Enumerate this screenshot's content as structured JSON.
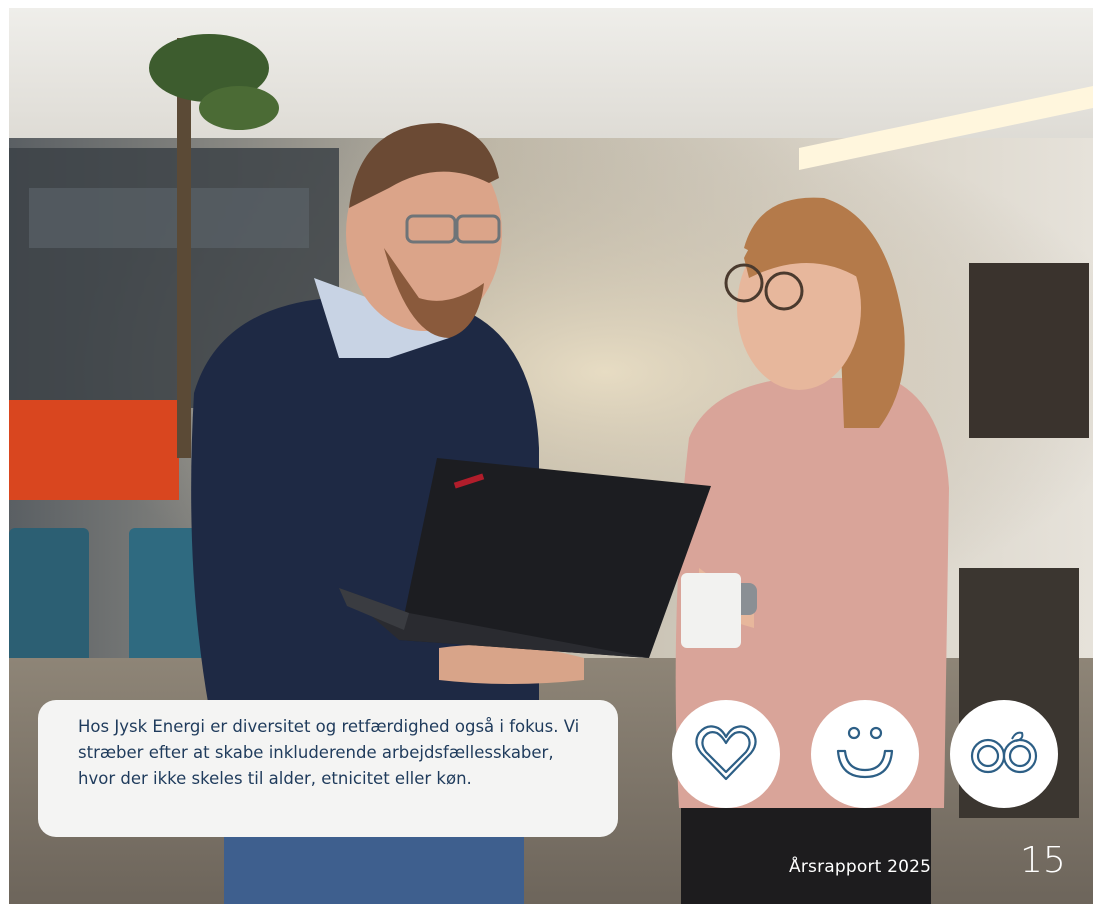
{
  "page": {
    "caption": "Hos Jysk Energi er diversitet og retfærdighed også i fokus. Vi stræber efter at skabe inkluderende arbejdsfællesskaber, hvor der ikke skeles til alder, etnicitet eller køn.",
    "footer_label": "Årsrapport 2025",
    "page_number": "15"
  },
  "photo": {
    "description_icon": "office-photo"
  },
  "badges": [
    {
      "icon": "heart-icon"
    },
    {
      "icon": "smiley-icon"
    },
    {
      "icon": "infinity-icon"
    }
  ],
  "colors": {
    "caption_text": "#1f3b5c",
    "caption_bg": "#f4f4f3",
    "icon_stroke": "#2d5f86",
    "footer_text": "#ffffff"
  }
}
